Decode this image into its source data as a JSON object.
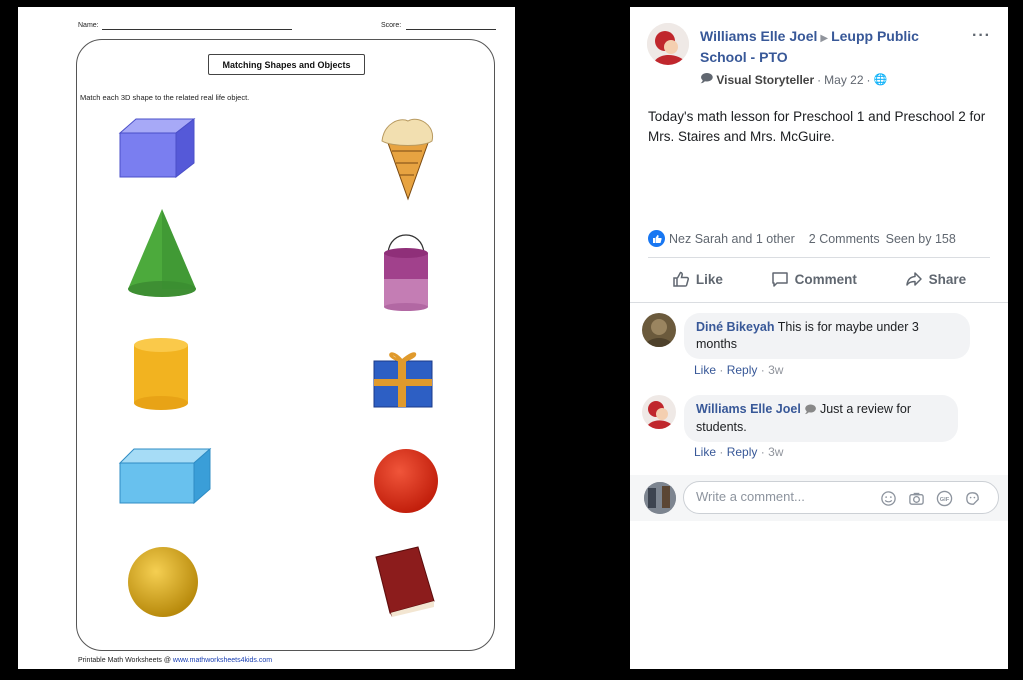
{
  "worksheet": {
    "name_label": "Name:",
    "score_label": "Score:",
    "title": "Matching Shapes and Objects",
    "instruction": "Match each 3D shape to the related real life object.",
    "footer_text": "Printable Math Worksheets @ ",
    "footer_link": "www.mathworksheets4kids.com",
    "left_shapes": [
      "cube-prism",
      "cone",
      "cylinder",
      "rectangular-prism",
      "sphere"
    ],
    "right_objects": [
      "ice-cream-cone",
      "bucket",
      "gift-box",
      "ball",
      "book"
    ]
  },
  "post": {
    "author": "Williams Elle Joel",
    "group": "Leupp Public School - PTO",
    "badge": "Visual Storyteller",
    "date": "May 22",
    "body": "Today's math lesson for Preschool 1 and Preschool 2 for Mrs. Staires and Mrs. McGuire.",
    "reactions": {
      "names": "Nez Sarah and 1 other",
      "comments": "2 Comments",
      "seen": "Seen by 158"
    },
    "actions": {
      "like": "Like",
      "comment": "Comment",
      "share": "Share"
    },
    "comments": [
      {
        "author": "Diné Bikeyah",
        "text": "This is for maybe under 3 months",
        "like": "Like",
        "reply": "Reply",
        "time": "3w"
      },
      {
        "author": "Williams Elle Joel",
        "text": "Just a review for students.",
        "like": "Like",
        "reply": "Reply",
        "time": "3w"
      }
    ],
    "write_placeholder": "Write a comment..."
  },
  "colors": {
    "link_blue": "#385898",
    "like_blue": "#1877f2",
    "bubble_gray": "#f2f3f5"
  }
}
